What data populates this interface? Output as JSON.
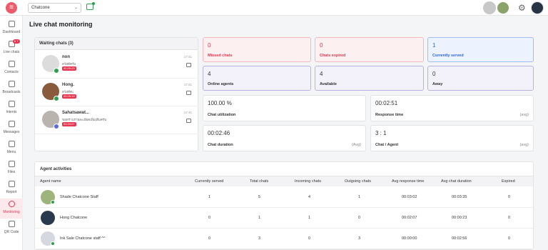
{
  "topbar": {
    "channel": "Chatcone"
  },
  "sidebar": {
    "items": [
      {
        "label": "Dashboard"
      },
      {
        "label": "Live chats",
        "badge": "6 7"
      },
      {
        "label": "Contacts"
      },
      {
        "label": "Broadcasts"
      },
      {
        "label": "Intents"
      },
      {
        "label": "Messages"
      },
      {
        "label": "Menu"
      },
      {
        "label": "Files"
      },
      {
        "label": "Report"
      },
      {
        "label": "Monitoring"
      },
      {
        "label": "QR Code"
      }
    ]
  },
  "page": {
    "title": "Live chat monitoring"
  },
  "waiting": {
    "title": "Waiting chats (3)",
    "chats": [
      {
        "name": "non",
        "message": "สวัสดีครับ",
        "timer": "00:29:23",
        "time": "17:41",
        "channel_color": "#2e9e4f"
      },
      {
        "name": "Hong.",
        "message": "สวัสดีค่ะ",
        "timer": "00:25:19",
        "time": "17:41",
        "channel_color": "#2e9e4f"
      },
      {
        "name": "Sahatsawat...",
        "message": "ขอทราบรายละเอียดเพิ่มเติมครับ",
        "timer": "00:29:07",
        "time": "17:41",
        "channel_color": "#5b6ae0"
      }
    ]
  },
  "stats": {
    "missed": {
      "value": "0",
      "label": "Missed chats"
    },
    "expired": {
      "value": "0",
      "label": "Chats expired"
    },
    "served": {
      "value": "1",
      "label": "Currently served"
    },
    "online": {
      "value": "4",
      "label": "Online agents"
    },
    "available": {
      "value": "4",
      "label": "Available"
    },
    "away": {
      "value": "0",
      "label": "Away"
    },
    "utilization": {
      "value": "100.00 %",
      "label": "Chat utilization"
    },
    "response": {
      "value": "00:02:51",
      "label": "Response time",
      "suffix": "(avg)"
    },
    "duration": {
      "value": "00:02:46",
      "label": "Chat duration",
      "suffix": "(Avg)"
    },
    "ratio": {
      "value": "3 : 1",
      "label": "Chat / Agent",
      "suffix": "(avg)"
    }
  },
  "activities": {
    "title": "Agent activities",
    "columns": [
      "Agent name",
      "Currently served",
      "Total chats",
      "Incoming chats",
      "Outgoing chats",
      "Avg response time",
      "Avg chat duration",
      "Expired"
    ],
    "rows": [
      {
        "name": "Shade Chatcone Staff",
        "served": "1",
        "total": "5",
        "incoming": "4",
        "outgoing": "1",
        "avg_response": "00:03:02",
        "avg_duration": "00:03:35",
        "expired": "0"
      },
      {
        "name": "Hong Chatcone",
        "served": "0",
        "total": "1",
        "incoming": "1",
        "outgoing": "0",
        "avg_response": "00:02:07",
        "avg_duration": "00:00:23",
        "expired": "0"
      },
      {
        "name": "Ink Sale Chatcone staff ^^",
        "served": "0",
        "total": "3",
        "incoming": "0",
        "outgoing": "3",
        "avg_response": "00:00:00",
        "avg_duration": "00:02:56",
        "expired": "0"
      }
    ]
  }
}
